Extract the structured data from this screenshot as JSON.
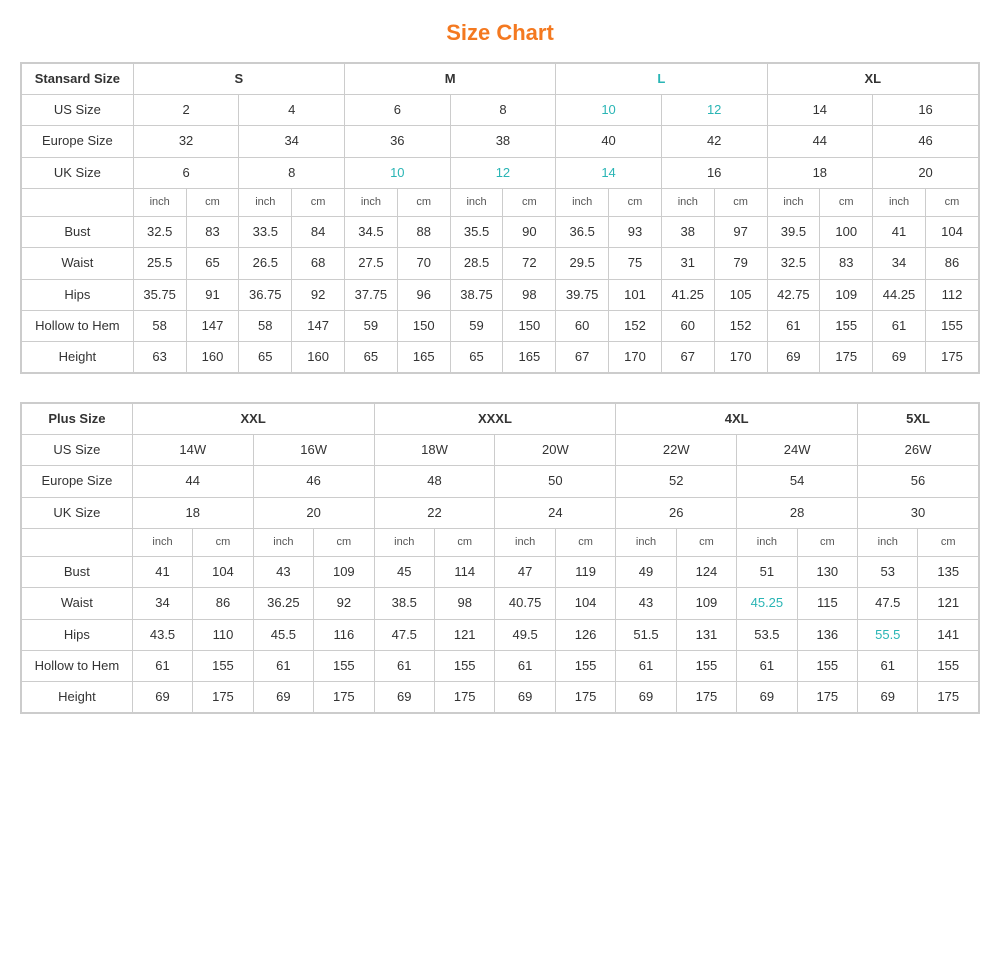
{
  "title": "Size Chart",
  "standard_table": {
    "headers": {
      "col1": "Stansard Size",
      "s": "S",
      "m": "M",
      "l": "L",
      "xl": "XL"
    },
    "us_size": {
      "label": "US Size",
      "values": [
        "2",
        "4",
        "6",
        "8",
        "10",
        "12",
        "14",
        "16"
      ]
    },
    "europe_size": {
      "label": "Europe Size",
      "values": [
        "32",
        "34",
        "36",
        "38",
        "40",
        "42",
        "44",
        "46"
      ]
    },
    "uk_size": {
      "label": "UK Size",
      "values": [
        "6",
        "8",
        "10",
        "12",
        "14",
        "16",
        "18",
        "20"
      ]
    },
    "units": [
      "inch",
      "cm",
      "inch",
      "cm",
      "inch",
      "cm",
      "inch",
      "cm",
      "inch",
      "cm",
      "inch",
      "cm",
      "inch",
      "cm",
      "inch",
      "cm"
    ],
    "bust": {
      "label": "Bust",
      "values": [
        "32.5",
        "83",
        "33.5",
        "84",
        "34.5",
        "88",
        "35.5",
        "90",
        "36.5",
        "93",
        "38",
        "97",
        "39.5",
        "100",
        "41",
        "104"
      ]
    },
    "waist": {
      "label": "Waist",
      "values": [
        "25.5",
        "65",
        "26.5",
        "68",
        "27.5",
        "70",
        "28.5",
        "72",
        "29.5",
        "75",
        "31",
        "79",
        "32.5",
        "83",
        "34",
        "86"
      ]
    },
    "hips": {
      "label": "Hips",
      "values": [
        "35.75",
        "91",
        "36.75",
        "92",
        "37.75",
        "96",
        "38.75",
        "98",
        "39.75",
        "101",
        "41.25",
        "105",
        "42.75",
        "109",
        "44.25",
        "112"
      ]
    },
    "hollow_to_hem": {
      "label": "Hollow to Hem",
      "values": [
        "58",
        "147",
        "58",
        "147",
        "59",
        "150",
        "59",
        "150",
        "60",
        "152",
        "60",
        "152",
        "61",
        "155",
        "61",
        "155"
      ]
    },
    "height": {
      "label": "Height",
      "values": [
        "63",
        "160",
        "65",
        "160",
        "65",
        "165",
        "65",
        "165",
        "67",
        "170",
        "67",
        "170",
        "69",
        "175",
        "69",
        "175"
      ]
    }
  },
  "plus_table": {
    "headers": {
      "col1": "Plus Size",
      "xxl": "XXL",
      "xxxl": "XXXL",
      "4xl": "4XL",
      "5xl": "5XL"
    },
    "us_size": {
      "label": "US Size",
      "values": [
        "14W",
        "16W",
        "18W",
        "20W",
        "22W",
        "24W",
        "26W"
      ]
    },
    "europe_size": {
      "label": "Europe Size",
      "values": [
        "44",
        "46",
        "48",
        "50",
        "52",
        "54",
        "56"
      ]
    },
    "uk_size": {
      "label": "UK Size",
      "values": [
        "18",
        "20",
        "22",
        "24",
        "26",
        "28",
        "30"
      ]
    },
    "units": [
      "inch",
      "cm",
      "inch",
      "cm",
      "inch",
      "cm",
      "inch",
      "cm",
      "inch",
      "cm",
      "inch",
      "cm",
      "inch",
      "cm"
    ],
    "bust": {
      "label": "Bust",
      "values": [
        "41",
        "104",
        "43",
        "109",
        "45",
        "114",
        "47",
        "119",
        "49",
        "124",
        "51",
        "130",
        "53",
        "135"
      ]
    },
    "waist": {
      "label": "Waist",
      "values": [
        "34",
        "86",
        "36.25",
        "92",
        "38.5",
        "98",
        "40.75",
        "104",
        "43",
        "109",
        "45.25",
        "115",
        "47.5",
        "121"
      ]
    },
    "hips": {
      "label": "Hips",
      "values": [
        "43.5",
        "110",
        "45.5",
        "116",
        "47.5",
        "121",
        "49.5",
        "126",
        "51.5",
        "131",
        "53.5",
        "136",
        "55.5",
        "141"
      ]
    },
    "hollow_to_hem": {
      "label": "Hollow to Hem",
      "values": [
        "61",
        "155",
        "61",
        "155",
        "61",
        "155",
        "61",
        "155",
        "61",
        "155",
        "61",
        "155",
        "61",
        "155"
      ]
    },
    "height": {
      "label": "Height",
      "values": [
        "69",
        "175",
        "69",
        "175",
        "69",
        "175",
        "69",
        "175",
        "69",
        "175",
        "69",
        "175",
        "69",
        "175"
      ]
    }
  }
}
